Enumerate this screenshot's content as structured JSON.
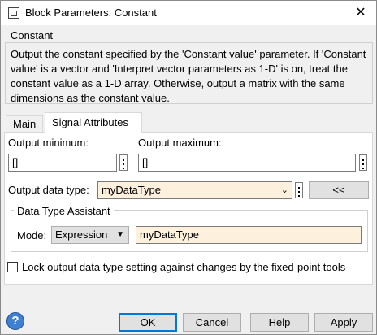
{
  "window": {
    "title": "Block Parameters: Constant",
    "close_symbol": "✕"
  },
  "description": {
    "group_title": "Constant",
    "text": "Output the constant specified by the 'Constant value' parameter. If 'Constant value' is a vector and 'Interpret vector parameters as 1-D' is on, treat the constant value as a 1-D array. Otherwise, output a matrix with the same dimensions as the constant value."
  },
  "tabs": [
    {
      "label": "Main",
      "active": false
    },
    {
      "label": "Signal Attributes",
      "active": true
    }
  ],
  "signal_attributes": {
    "output_min_label": "Output minimum:",
    "output_min_value": "[]",
    "output_max_label": "Output maximum:",
    "output_max_value": "[]",
    "data_type_label": "Output data type:",
    "data_type_value": "myDataType",
    "assistant_toggle_label": "<<",
    "assistant": {
      "title": "Data Type Assistant",
      "mode_label": "Mode:",
      "mode_value": "Expression",
      "expression_value": "myDataType"
    },
    "lock_label": "Lock output data type setting against changes by the fixed-point tools",
    "lock_checked": false
  },
  "buttons": {
    "help_symbol": "?",
    "ok": "OK",
    "cancel": "Cancel",
    "help": "Help",
    "apply": "Apply"
  },
  "colors": {
    "highlight_field": "#fdf0dc",
    "default_button_border": "#0078d7",
    "help_icon": "#3f7fd4"
  }
}
